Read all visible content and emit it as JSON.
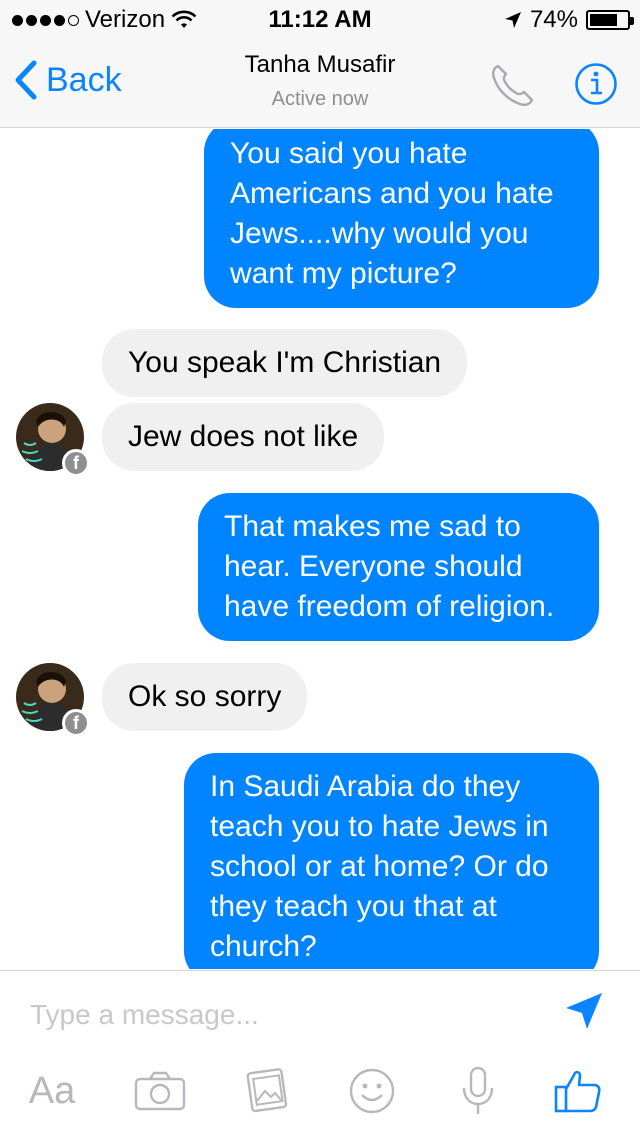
{
  "status_bar": {
    "carrier": "Verizon",
    "time": "11:12 AM",
    "battery": "74%",
    "battery_level": 0.74,
    "signal_bars": 4
  },
  "nav": {
    "back_label": "Back",
    "contact_name": "Tanha Musafir",
    "status": "Active now"
  },
  "messages": [
    {
      "direction": "outgoing",
      "text": "You said you hate Americans and you hate Jews....why would you want my picture?"
    },
    {
      "direction": "incoming",
      "text": "You speak I'm Christian"
    },
    {
      "direction": "incoming",
      "text": "Jew does not like"
    },
    {
      "direction": "outgoing",
      "text": "That makes me sad to hear. Everyone should have freedom of religion."
    },
    {
      "direction": "incoming",
      "text": "Ok so sorry"
    },
    {
      "direction": "outgoing",
      "text": "In Saudi Arabia do they teach you to hate Jews in school or at home? Or do they teach you that at church?"
    }
  ],
  "composer": {
    "placeholder": "Type a message...",
    "text_format_label": "Aa"
  },
  "colors": {
    "accent": "#0a84ff",
    "outgoing_bubble": "#0084ff",
    "incoming_bubble": "#f1f0f0",
    "icon_gray": "#b8b8bc"
  },
  "icons": [
    "location-arrow-icon",
    "wifi-icon",
    "phone-icon",
    "info-icon",
    "send-icon",
    "camera-icon",
    "gallery-icon",
    "emoji-icon",
    "microphone-icon",
    "thumbs-up-icon",
    "facebook-badge-icon"
  ]
}
